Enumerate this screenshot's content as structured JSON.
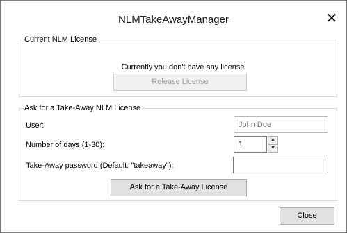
{
  "window": {
    "title": "NLMTakeAwayManager",
    "close_icon": "close-icon"
  },
  "current_license": {
    "legend": "Current NLM License",
    "status_text": "Currently you don't have any license",
    "release_button": "Release License",
    "release_enabled": false
  },
  "takeaway": {
    "legend": "Ask for a Take-Away NLM License",
    "user_label": "User:",
    "user_value": "John Doe",
    "days_label": "Number of days (1-30):",
    "days_value": "1",
    "spin_up_icon": "spin-up-icon",
    "spin_down_icon": "spin-down-icon",
    "password_label": "Take-Away password (Default: \"takeaway\"):",
    "password_value": "",
    "ask_button": "Ask for a Take-Away License"
  },
  "footer": {
    "close_button": "Close"
  }
}
